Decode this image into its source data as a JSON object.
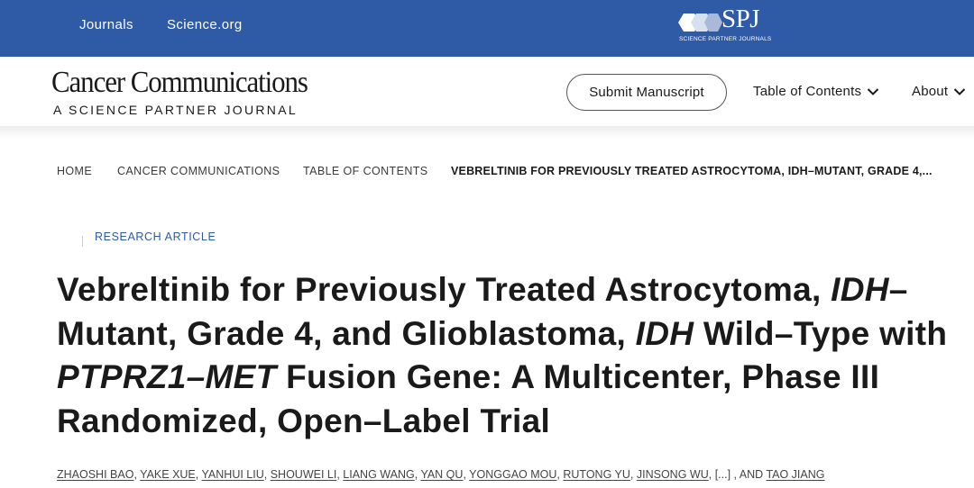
{
  "topbar": {
    "links": [
      "Journals",
      "Science.org"
    ],
    "brand_mark": "SPJ",
    "brand_sub": "SCIENCE PARTNER JOURNALS",
    "bg_color": "#2e5aa6"
  },
  "header": {
    "journal_title": "Cancer Communications",
    "journal_subtitle": "A SCIENCE PARTNER JOURNAL",
    "submit_label": "Submit Manuscript",
    "menu": [
      {
        "label": "Table of Contents",
        "icon": "chevron-down-icon"
      },
      {
        "label": "About",
        "icon": "chevron-down-icon"
      }
    ]
  },
  "breadcrumb": [
    "HOME",
    "CANCER COMMUNICATIONS",
    "TABLE OF CONTENTS",
    "VEBRELTINIB FOR PREVIOUSLY TREATED ASTROCYTOMA, IDH–MUTANT, GRADE 4,..."
  ],
  "article": {
    "type": "RESEARCH ARTICLE",
    "title_segments": [
      {
        "text": "Vebreltinib for Previously Treated Astrocytoma, ",
        "italic": false
      },
      {
        "text": "IDH",
        "italic": true
      },
      {
        "text": "–Mutant, Grade 4, and Glioblastoma, ",
        "italic": false
      },
      {
        "text": "IDH",
        "italic": true
      },
      {
        "text": " Wild–Type with ",
        "italic": false
      },
      {
        "text": "PTPRZ1–MET",
        "italic": true
      },
      {
        "text": " Fusion Gene: A Multicenter, Phase III Randomized, Open–Label Trial",
        "italic": false
      }
    ],
    "authors": [
      "ZHAOSHI BAO",
      "YAKE XUE",
      "YANHUI LIU",
      "SHOUWEI LI",
      "LIANG WANG",
      "YAN QU",
      "YONGGAO MOU",
      "RUTONG YU",
      "JINSONG WU"
    ],
    "authors_more": "[...]",
    "authors_and": "AND",
    "last_author": "TAO JIANG"
  },
  "colors": {
    "accent": "#2e5aa6",
    "text": "#1a1a1a"
  }
}
